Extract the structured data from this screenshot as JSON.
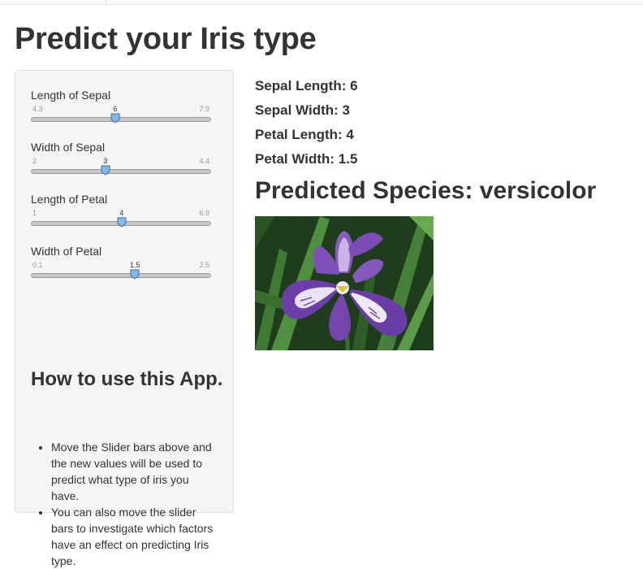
{
  "title": "Predict your Iris type",
  "sliders": [
    {
      "label": "Length of Sepal",
      "min": "4.3",
      "max": "7.9",
      "value": "6",
      "fraction": 0.472
    },
    {
      "label": "Width of Sepal",
      "min": "2",
      "max": "4.4",
      "value": "3",
      "fraction": 0.417
    },
    {
      "label": "Length of Petal",
      "min": "1",
      "max": "6.9",
      "value": "4",
      "fraction": 0.508
    },
    {
      "label": "Width of Petal",
      "min": "0.1",
      "max": "2.5",
      "value": "1.5",
      "fraction": 0.583
    }
  ],
  "howto": {
    "title": "How to use this App.",
    "items": [
      "Move the Slider bars above and the new values will be used to predict what type of iris you have.",
      "You can also move the slider bars to investigate which factors have an effect on predicting Iris type."
    ]
  },
  "results": {
    "sepal_length": "Sepal Length: 6",
    "sepal_width": "Sepal Width: 3",
    "petal_length": "Petal Length: 4",
    "petal_width": "Petal Width: 1.5",
    "prediction": "Predicted Species: versicolor"
  },
  "icons": {
    "slider_handle": "slider-handle-icon",
    "flower_image": "iris-versicolor-photo"
  },
  "colors": {
    "handle_fill": "#8ab6e6",
    "handle_stroke": "#3a6fa8",
    "track": "#c8c8c8",
    "sidebar_bg": "#f5f5f5",
    "text": "#333333"
  }
}
